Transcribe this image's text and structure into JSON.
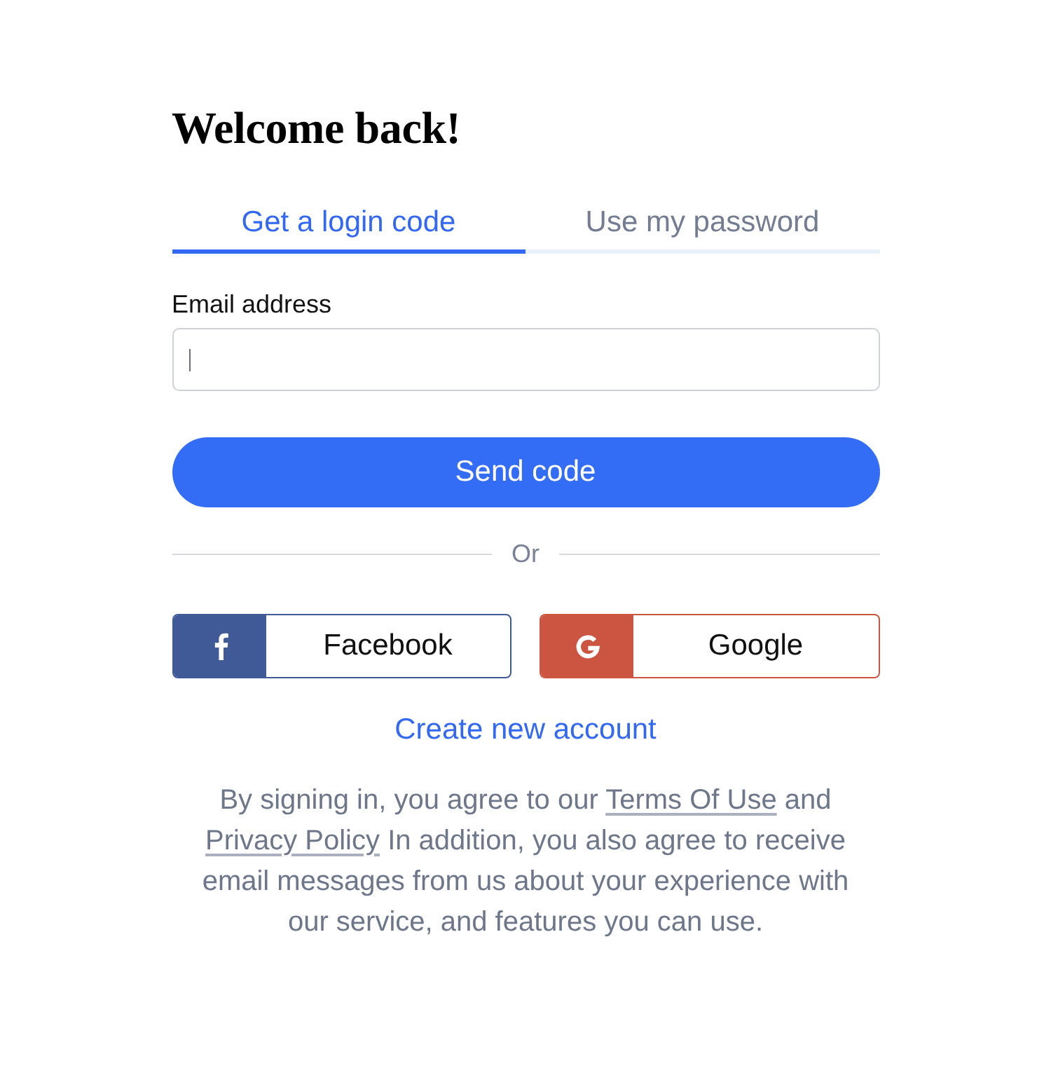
{
  "heading": "Welcome back!",
  "tabs": [
    {
      "label": "Get a login code",
      "selected": true
    },
    {
      "label": "Use my password",
      "selected": false
    }
  ],
  "email_field": {
    "label": "Email address",
    "focused": true
  },
  "submit_button": "Send code",
  "divider": "Or",
  "social_buttons": [
    {
      "kind": "facebook",
      "label": "Facebook",
      "color": "#3f5a96"
    },
    {
      "kind": "google",
      "label": "Google",
      "color": "#cc5541"
    }
  ],
  "create_account_link": "Create new account",
  "legal_notice": [
    {
      "kind": "text",
      "text": "By signing in, you agree to our "
    },
    {
      "kind": "link",
      "text": "Terms Of Use"
    },
    {
      "kind": "text",
      "text": " and "
    },
    {
      "kind": "link",
      "text": "Privacy Policy"
    },
    {
      "kind": "text",
      "text": " In addition, you also agree to receive email messages from us about your experience with our service, and features you can use."
    }
  ]
}
